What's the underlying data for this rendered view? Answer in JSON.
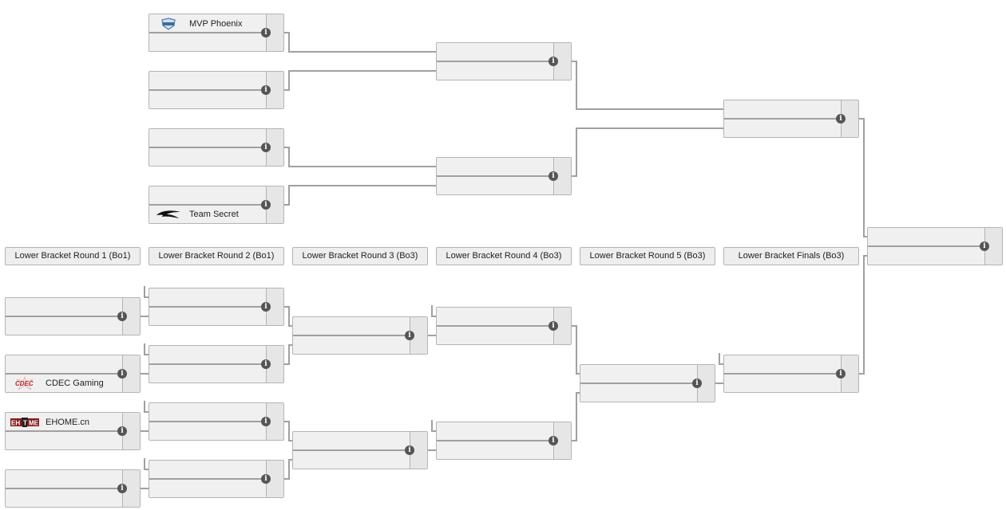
{
  "info_glyph": "i",
  "round_headers": [
    {
      "label": "Lower Bracket Round 1 (Bo1)"
    },
    {
      "label": "Lower Bracket Round 2 (Bo1)"
    },
    {
      "label": "Lower Bracket Round 3 (Bo3)"
    },
    {
      "label": "Lower Bracket Round 4 (Bo3)"
    },
    {
      "label": "Lower Bracket Round 5 (Bo3)"
    },
    {
      "label": "Lower Bracket Finals (Bo3)"
    }
  ],
  "upper_bracket": {
    "round1": [
      {
        "top": {
          "team": "MVP Phoenix",
          "logo": "mvp-phoenix-logo"
        },
        "bottom": {
          "team": "",
          "logo": ""
        }
      },
      {
        "top": {
          "team": "",
          "logo": ""
        },
        "bottom": {
          "team": "",
          "logo": ""
        }
      },
      {
        "top": {
          "team": "",
          "logo": ""
        },
        "bottom": {
          "team": "",
          "logo": ""
        }
      },
      {
        "top": {
          "team": "",
          "logo": ""
        },
        "bottom": {
          "team": "Team Secret",
          "logo": "team-secret-logo"
        }
      }
    ],
    "round2": [
      {
        "top": {
          "team": "",
          "logo": ""
        },
        "bottom": {
          "team": "",
          "logo": ""
        }
      },
      {
        "top": {
          "team": "",
          "logo": ""
        },
        "bottom": {
          "team": "",
          "logo": ""
        }
      }
    ],
    "round3": [
      {
        "top": {
          "team": "",
          "logo": ""
        },
        "bottom": {
          "team": "",
          "logo": ""
        }
      }
    ]
  },
  "grand_final": {
    "top": {
      "team": "",
      "logo": ""
    },
    "bottom": {
      "team": "",
      "logo": ""
    }
  },
  "lower_bracket": {
    "round1": [
      {
        "top": {
          "team": "",
          "logo": ""
        },
        "bottom": {
          "team": "",
          "logo": ""
        }
      },
      {
        "top": {
          "team": "",
          "logo": ""
        },
        "bottom": {
          "team": "CDEC Gaming",
          "logo": "cdec-gaming-logo"
        }
      },
      {
        "top": {
          "team": "EHOME.cn",
          "logo": "ehome-logo"
        },
        "bottom": {
          "team": "",
          "logo": ""
        }
      },
      {
        "top": {
          "team": "",
          "logo": ""
        },
        "bottom": {
          "team": "",
          "logo": ""
        }
      }
    ],
    "round2": [
      {
        "top": {
          "team": "",
          "logo": ""
        },
        "bottom": {
          "team": "",
          "logo": ""
        }
      },
      {
        "top": {
          "team": "",
          "logo": ""
        },
        "bottom": {
          "team": "",
          "logo": ""
        }
      },
      {
        "top": {
          "team": "",
          "logo": ""
        },
        "bottom": {
          "team": "",
          "logo": ""
        }
      },
      {
        "top": {
          "team": "",
          "logo": ""
        },
        "bottom": {
          "team": "",
          "logo": ""
        }
      }
    ],
    "round3": [
      {
        "top": {
          "team": "",
          "logo": ""
        },
        "bottom": {
          "team": "",
          "logo": ""
        }
      },
      {
        "top": {
          "team": "",
          "logo": ""
        },
        "bottom": {
          "team": "",
          "logo": ""
        }
      }
    ],
    "round4": [
      {
        "top": {
          "team": "",
          "logo": ""
        },
        "bottom": {
          "team": "",
          "logo": ""
        }
      },
      {
        "top": {
          "team": "",
          "logo": ""
        },
        "bottom": {
          "team": "",
          "logo": ""
        }
      }
    ],
    "round5": [
      {
        "top": {
          "team": "",
          "logo": ""
        },
        "bottom": {
          "team": "",
          "logo": ""
        }
      }
    ],
    "finals": [
      {
        "top": {
          "team": "",
          "logo": ""
        },
        "bottom": {
          "team": "",
          "logo": ""
        }
      }
    ]
  }
}
